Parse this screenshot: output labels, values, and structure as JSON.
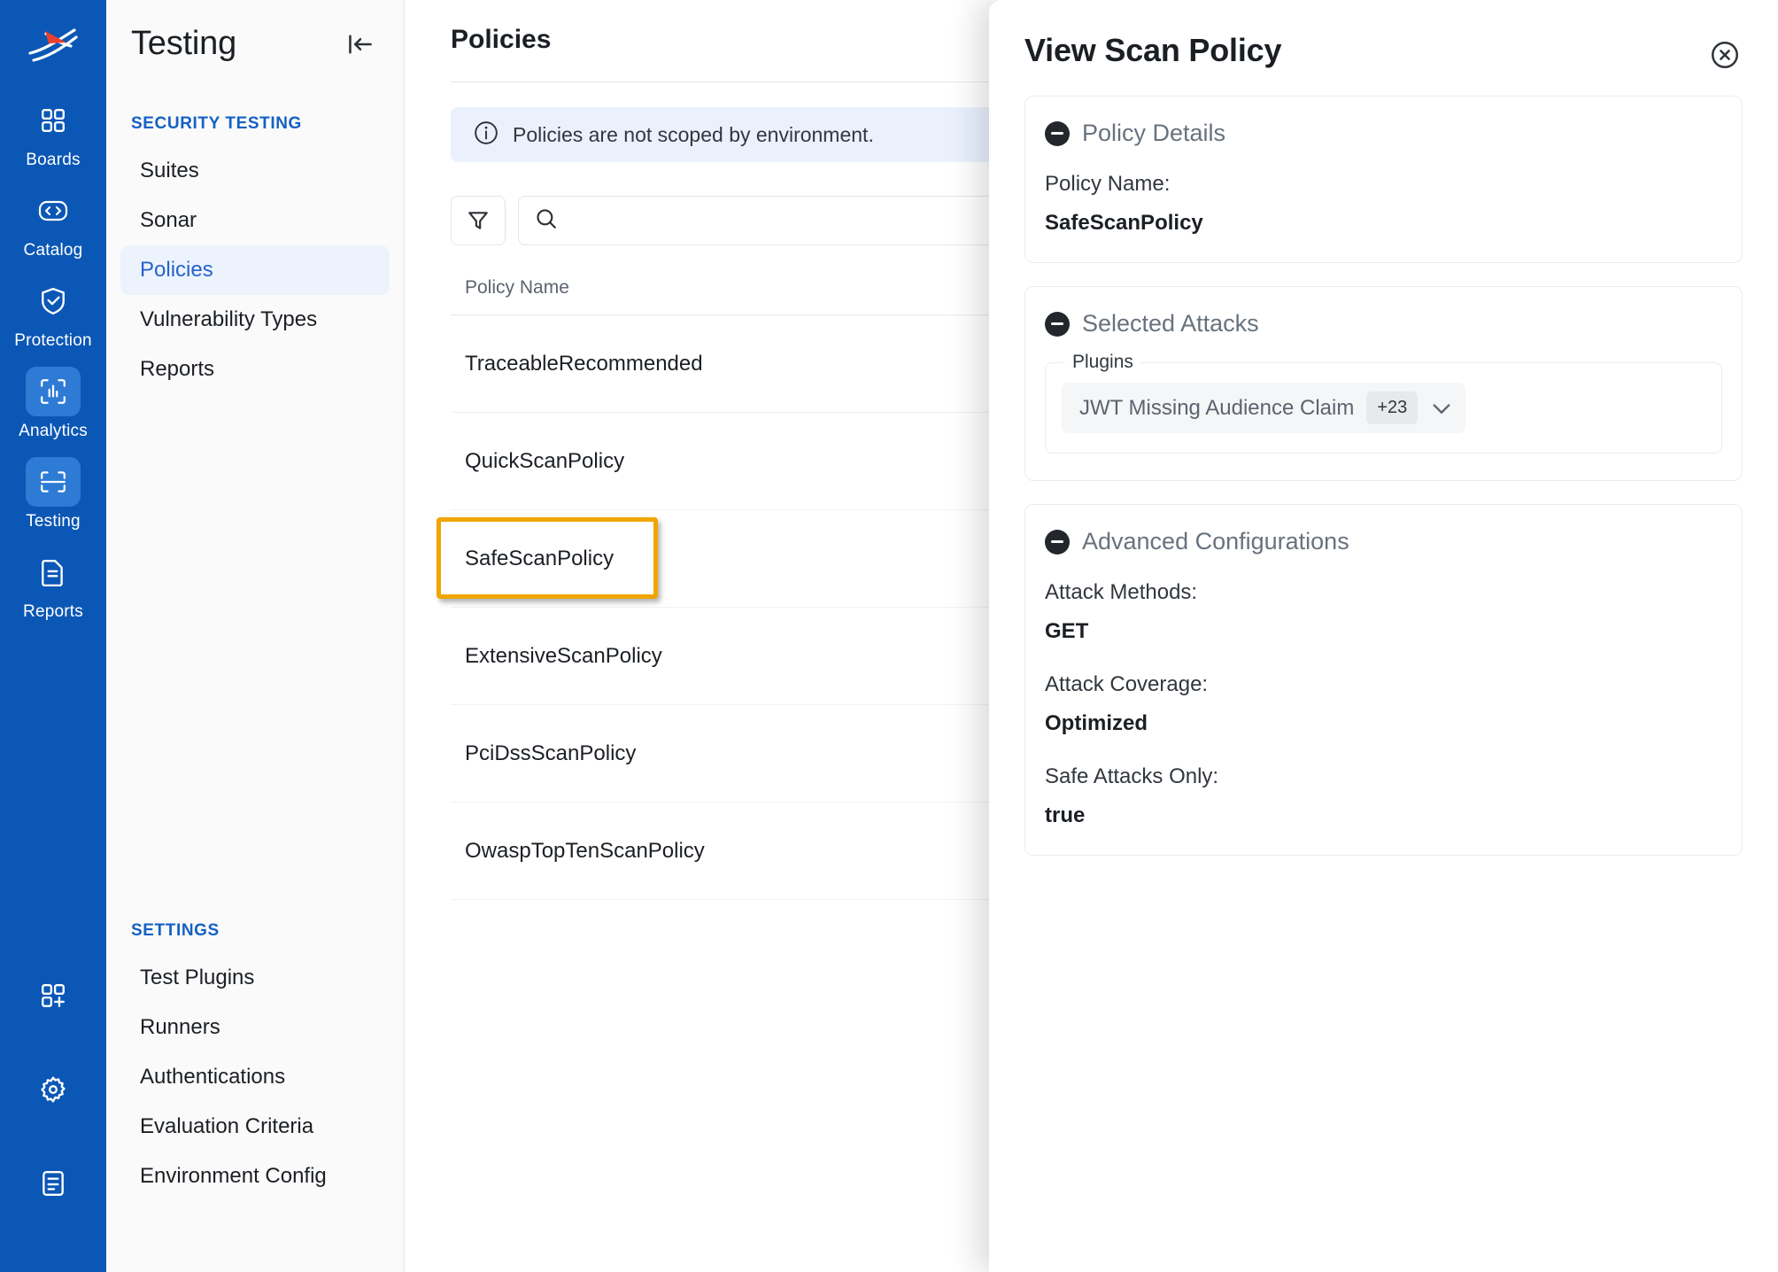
{
  "rail": {
    "logo_icon": "traceable-logo-icon",
    "items": [
      {
        "label": "Boards",
        "icon": "grid-icon",
        "active": false
      },
      {
        "label": "Catalog",
        "icon": "code-brackets-icon",
        "active": false
      },
      {
        "label": "Protection",
        "icon": "shield-check-icon",
        "active": false
      },
      {
        "label": "Analytics",
        "icon": "analytics-scan-icon",
        "active": true
      },
      {
        "label": "Testing",
        "icon": "testing-frame-icon",
        "active": true
      },
      {
        "label": "Reports",
        "icon": "document-lines-icon",
        "active": false
      }
    ],
    "bottom_items": [
      {
        "icon": "add-app-icon"
      },
      {
        "icon": "gear-icon"
      },
      {
        "icon": "book-icon"
      }
    ]
  },
  "sidebar": {
    "title": "Testing",
    "collapse_icon": "collapse-left-icon",
    "groups": [
      {
        "title": "SECURITY TESTING",
        "items": [
          {
            "label": "Suites",
            "active": false
          },
          {
            "label": "Sonar",
            "active": false
          },
          {
            "label": "Policies",
            "active": true
          },
          {
            "label": "Vulnerability Types",
            "active": false
          },
          {
            "label": "Reports",
            "active": false
          }
        ]
      },
      {
        "title": "SETTINGS",
        "items": [
          {
            "label": "Test Plugins",
            "active": false
          },
          {
            "label": "Runners",
            "active": false
          },
          {
            "label": "Authentications",
            "active": false
          },
          {
            "label": "Evaluation Criteria",
            "active": false
          },
          {
            "label": "Environment Config",
            "active": false
          }
        ]
      }
    ]
  },
  "main": {
    "page_title": "Policies",
    "info_banner": {
      "icon": "info-circle-icon",
      "text": "Policies are not scoped by environment."
    },
    "toolbar": {
      "filter_icon": "filter-funnel-icon",
      "search_icon": "search-icon",
      "search_value": "",
      "search_placeholder": ""
    },
    "table": {
      "columns": [
        "Policy Name"
      ],
      "rows": [
        {
          "name": "TraceableRecommended",
          "highlighted": false
        },
        {
          "name": "QuickScanPolicy",
          "highlighted": false
        },
        {
          "name": "SafeScanPolicy",
          "highlighted": true
        },
        {
          "name": "ExtensiveScanPolicy",
          "highlighted": false
        },
        {
          "name": "PciDssScanPolicy",
          "highlighted": false
        },
        {
          "name": "OwaspTopTenScanPolicy",
          "highlighted": false
        }
      ]
    }
  },
  "drawer": {
    "title": "View Scan Policy",
    "close_icon": "close-circle-icon",
    "sections": [
      {
        "title": "Policy Details",
        "toggle_icon": "minus-circle-icon",
        "fields": [
          {
            "label": "Policy Name:",
            "value": "SafeScanPolicy"
          }
        ]
      },
      {
        "title": "Selected Attacks",
        "toggle_icon": "minus-circle-icon",
        "fieldset_legend": "Plugins",
        "chip": {
          "text": "JWT Missing Audience Claim",
          "count": "+23",
          "caret_icon": "chevron-down-icon"
        }
      },
      {
        "title": "Advanced Configurations",
        "toggle_icon": "minus-circle-icon",
        "fields": [
          {
            "label": "Attack Methods:",
            "value": "GET"
          },
          {
            "label": "Attack Coverage:",
            "value": "Optimized"
          },
          {
            "label": "Safe Attacks Only:",
            "value": "true"
          }
        ]
      }
    ]
  },
  "colors": {
    "rail_blue": "#0B57B5",
    "rail_active": "#2E7BD6",
    "accent_blue": "#1361C4",
    "nav_active_bg": "#EDF3FD",
    "nav_active_text": "#2563C9",
    "info_banner_bg": "#EAF1FD",
    "highlight_orange": "#F0A500"
  }
}
